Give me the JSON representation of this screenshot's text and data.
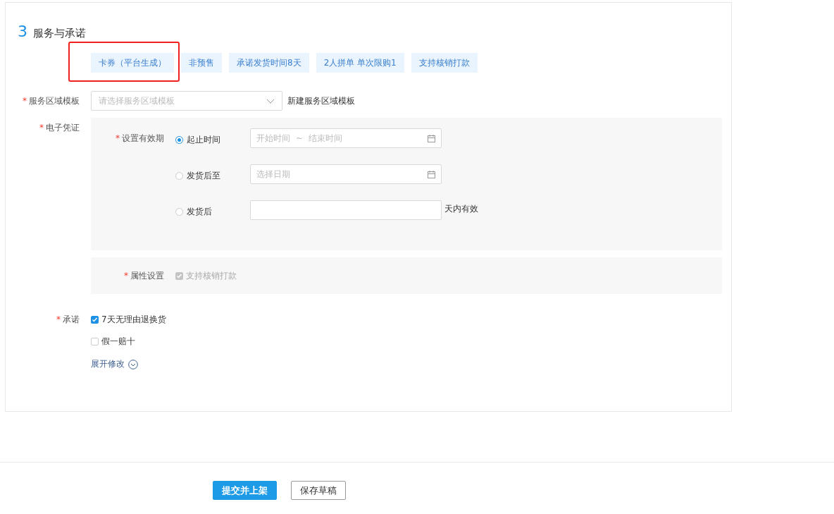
{
  "section": {
    "number": "3",
    "title": "服务与承诺"
  },
  "tags": [
    {
      "label": "卡券（平台生成）",
      "highlighted": true
    },
    {
      "label": "非预售",
      "highlighted": false
    },
    {
      "label": "承诺发货时间8天",
      "highlighted": false
    },
    {
      "label": "2人拼单 单次限购1",
      "highlighted": false
    },
    {
      "label": "支持核销打款",
      "highlighted": false
    }
  ],
  "service_area": {
    "required_mark": "*",
    "label": "服务区域模板",
    "placeholder": "请选择服务区域模板",
    "link": "新建服务区域模板"
  },
  "voucher": {
    "required_mark": "*",
    "label": "电子凭证",
    "validity": {
      "required_mark": "*",
      "label": "设置有效期",
      "options": [
        {
          "kind": "range",
          "label": "起止时间",
          "selected": true,
          "start_placeholder": "开始时间",
          "separator": "~",
          "end_placeholder": "结束时间"
        },
        {
          "kind": "date",
          "label": "发货后至",
          "selected": false,
          "placeholder": "选择日期"
        },
        {
          "kind": "days",
          "label": "发货后",
          "selected": false,
          "suffix": "天内有效"
        }
      ]
    },
    "attribute": {
      "required_mark": "*",
      "label": "属性设置",
      "option": {
        "label": "支持核销打款",
        "checked": true,
        "disabled": true
      }
    }
  },
  "promise": {
    "required_mark": "*",
    "label": "承诺",
    "options": [
      {
        "label": "7天无理由退换货",
        "checked": true
      },
      {
        "label": "假一赔十",
        "checked": false
      }
    ],
    "expand_link": "展开修改"
  },
  "buttons": [
    {
      "label": "提交并上架",
      "kind": "primary"
    },
    {
      "label": "保存草稿",
      "kind": "default"
    }
  ]
}
